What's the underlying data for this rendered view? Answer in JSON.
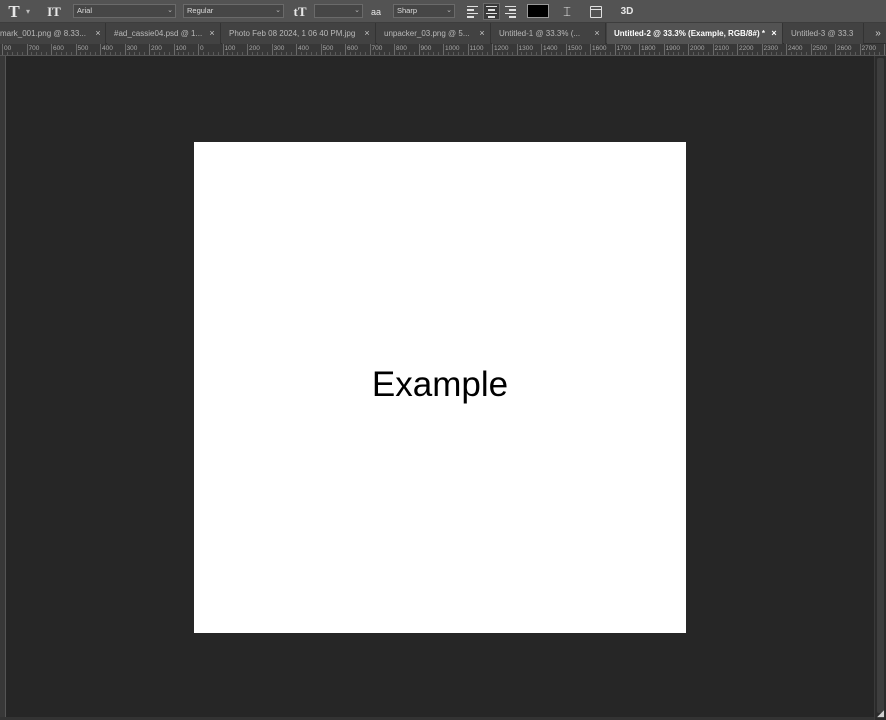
{
  "options_bar": {
    "tool_icon": "T",
    "tool_menu_icon": "chevron-down-icon",
    "orientation_icon": "IT",
    "font_family": "Arial",
    "font_style": "Regular",
    "size_icon": "tT",
    "font_size": "",
    "antialias_icon": "aa",
    "antialias": "Sharp",
    "text_color": "#000000",
    "warp_icon": "warp-text-icon",
    "three_d_label": "3D"
  },
  "tabs": [
    {
      "label": "mark_001.png @ 8.33...",
      "active": false
    },
    {
      "label": "#ad_cassie04.psd @ 1...",
      "active": false
    },
    {
      "label": "Photo Feb 08 2024, 1 06 40 PM.jpg",
      "active": false
    },
    {
      "label": "unpacker_03.png @ 5...",
      "active": false
    },
    {
      "label": "Untitled-1 @ 33.3% (...",
      "active": false
    },
    {
      "label": "Untitled-2 @ 33.3% (Example, RGB/8#) *",
      "active": true
    },
    {
      "label": "Untitled-3 @ 33.3",
      "active": false
    }
  ],
  "close_glyph": "×",
  "overflow_glyph": "»",
  "ruler": {
    "labels": [
      "00",
      "700",
      "600",
      "500",
      "400",
      "300",
      "200",
      "100",
      "0",
      "100",
      "200",
      "300",
      "400",
      "500",
      "600",
      "700",
      "800",
      "900",
      "1000",
      "1100",
      "1200",
      "1300",
      "1400",
      "1500",
      "1600",
      "1700",
      "1800",
      "1900",
      "2000",
      "2100",
      "2200",
      "2300",
      "2400",
      "2500",
      "2600",
      "2700",
      "28"
    ]
  },
  "document": {
    "text": "Example",
    "background": "#ffffff"
  },
  "resize_glyph": "◢"
}
